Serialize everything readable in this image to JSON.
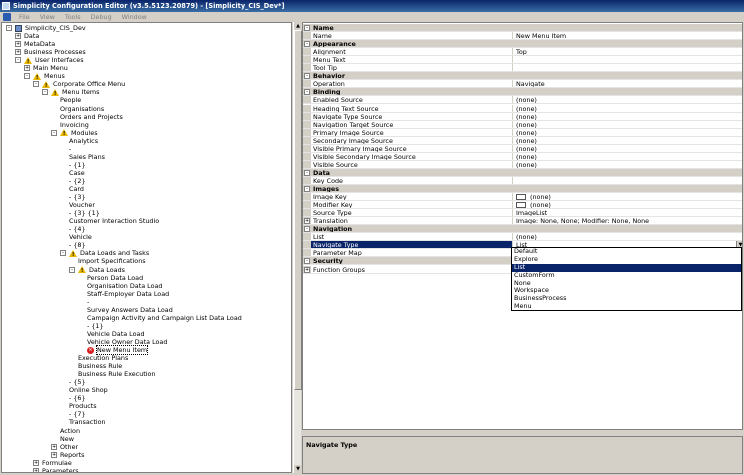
{
  "window": {
    "title": "Simplicity Configuration Editor (v3.5.5123.20879) - [Simplicity_CIS_Dev*]"
  },
  "menubar": {
    "items": [
      "File",
      "View",
      "Tools",
      "Debug",
      "Window"
    ]
  },
  "tree": {
    "nodes": [
      {
        "label": "Simplicity_CIS_Dev",
        "depth": 0,
        "exp": "-",
        "icon": "db-icon"
      },
      {
        "label": "Data",
        "depth": 1,
        "exp": "+",
        "icon": "none"
      },
      {
        "label": "MetaData",
        "depth": 1,
        "exp": "+",
        "icon": "none"
      },
      {
        "label": "Business Processes",
        "depth": 1,
        "exp": "+",
        "icon": "none"
      },
      {
        "label": "User Interfaces",
        "depth": 1,
        "exp": "-",
        "icon": "warn"
      },
      {
        "label": "Main Menu",
        "depth": 2,
        "exp": "+",
        "icon": "none"
      },
      {
        "label": "Menus",
        "depth": 2,
        "exp": "-",
        "icon": "warn"
      },
      {
        "label": "Corporate Office Menu",
        "depth": 3,
        "exp": "-",
        "icon": "warn"
      },
      {
        "label": "Menu Items",
        "depth": 4,
        "exp": "-",
        "icon": "warn"
      },
      {
        "label": "People",
        "depth": 5,
        "exp": "",
        "icon": "none"
      },
      {
        "label": "Organisations",
        "depth": 5,
        "exp": "",
        "icon": "none"
      },
      {
        "label": "Orders and Projects",
        "depth": 5,
        "exp": "",
        "icon": "none"
      },
      {
        "label": "Invoicing",
        "depth": 5,
        "exp": "",
        "icon": "none"
      },
      {
        "label": "Modules",
        "depth": 5,
        "exp": "-",
        "icon": "warn"
      },
      {
        "label": "Analytics",
        "depth": 6,
        "exp": "",
        "icon": "none"
      },
      {
        "label": "-",
        "depth": 6,
        "exp": "",
        "icon": "none"
      },
      {
        "label": "Sales Plans",
        "depth": 6,
        "exp": "",
        "icon": "none"
      },
      {
        "label": "- {1}",
        "depth": 6,
        "exp": "",
        "icon": "none"
      },
      {
        "label": "Case",
        "depth": 6,
        "exp": "",
        "icon": "none"
      },
      {
        "label": "- {2}",
        "depth": 6,
        "exp": "",
        "icon": "none"
      },
      {
        "label": "Card",
        "depth": 6,
        "exp": "",
        "icon": "none"
      },
      {
        "label": "- {3}",
        "depth": 6,
        "exp": "",
        "icon": "none"
      },
      {
        "label": "Voucher",
        "depth": 6,
        "exp": "",
        "icon": "none"
      },
      {
        "label": "- {3} {1}",
        "depth": 6,
        "exp": "",
        "icon": "none"
      },
      {
        "label": "Customer Interaction Studio",
        "depth": 6,
        "exp": "",
        "icon": "none"
      },
      {
        "label": "- {4}",
        "depth": 6,
        "exp": "",
        "icon": "none"
      },
      {
        "label": "Vehicle",
        "depth": 6,
        "exp": "",
        "icon": "none"
      },
      {
        "label": "- {8}",
        "depth": 6,
        "exp": "",
        "icon": "none"
      },
      {
        "label": "Data Loads and Tasks",
        "depth": 6,
        "exp": "-",
        "icon": "warn"
      },
      {
        "label": "Import Specifications",
        "depth": 7,
        "exp": "",
        "icon": "none"
      },
      {
        "label": "Data Loads",
        "depth": 7,
        "exp": "-",
        "icon": "warn"
      },
      {
        "label": "Person Data Load",
        "depth": 8,
        "exp": "",
        "icon": "none"
      },
      {
        "label": "Organisation Data Load",
        "depth": 8,
        "exp": "",
        "icon": "none"
      },
      {
        "label": "Staff-Employer Data Load",
        "depth": 8,
        "exp": "",
        "icon": "none"
      },
      {
        "label": "-",
        "depth": 8,
        "exp": "",
        "icon": "none"
      },
      {
        "label": "Survey Answers Data Load",
        "depth": 8,
        "exp": "",
        "icon": "none"
      },
      {
        "label": "Campaign Activity and Campaign List Data Load",
        "depth": 8,
        "exp": "",
        "icon": "none"
      },
      {
        "label": "- {1}",
        "depth": 8,
        "exp": "",
        "icon": "none"
      },
      {
        "label": "Vehicle Data Load",
        "depth": 8,
        "exp": "",
        "icon": "none"
      },
      {
        "label": "Vehicle Owner Data Load",
        "depth": 8,
        "exp": "",
        "icon": "none"
      },
      {
        "label": "New Menu Item",
        "depth": 8,
        "exp": "",
        "icon": "err"
      },
      {
        "label": "Execution Plans",
        "depth": 7,
        "exp": "",
        "icon": "none"
      },
      {
        "label": "Business Rule",
        "depth": 7,
        "exp": "",
        "icon": "none"
      },
      {
        "label": "Business Rule Execution",
        "depth": 7,
        "exp": "",
        "icon": "none"
      },
      {
        "label": "- {5}",
        "depth": 6,
        "exp": "",
        "icon": "none"
      },
      {
        "label": "Online Shop",
        "depth": 6,
        "exp": "",
        "icon": "none"
      },
      {
        "label": "- {6}",
        "depth": 6,
        "exp": "",
        "icon": "none"
      },
      {
        "label": "Products",
        "depth": 6,
        "exp": "",
        "icon": "none"
      },
      {
        "label": "- {7}",
        "depth": 6,
        "exp": "",
        "icon": "none"
      },
      {
        "label": "Transaction",
        "depth": 6,
        "exp": "",
        "icon": "none"
      },
      {
        "label": "Action",
        "depth": 5,
        "exp": "",
        "icon": "none"
      },
      {
        "label": "New",
        "depth": 5,
        "exp": "",
        "icon": "none"
      },
      {
        "label": "Other",
        "depth": 5,
        "exp": "+",
        "icon": "none"
      },
      {
        "label": "Reports",
        "depth": 5,
        "exp": "+",
        "icon": "none"
      },
      {
        "label": "Formulae",
        "depth": 3,
        "exp": "+",
        "icon": "none"
      },
      {
        "label": "Parameters",
        "depth": 3,
        "exp": "+",
        "icon": "none"
      }
    ]
  },
  "properties": {
    "rows": [
      {
        "type": "cat",
        "label": "Name",
        "value": ""
      },
      {
        "type": "prop",
        "label": "Name",
        "value": "New Menu Item"
      },
      {
        "type": "cat",
        "label": "Appearance",
        "value": ""
      },
      {
        "type": "prop",
        "label": "Alignment",
        "value": "Top"
      },
      {
        "type": "prop",
        "label": "Menu Text",
        "value": ""
      },
      {
        "type": "prop",
        "label": "Tool Tip",
        "value": ""
      },
      {
        "type": "cat",
        "label": "Behavior",
        "value": ""
      },
      {
        "type": "prop",
        "label": "Operation",
        "value": "Navigate"
      },
      {
        "type": "cat",
        "label": "Binding",
        "value": ""
      },
      {
        "type": "prop",
        "label": "Enabled Source",
        "value": "(none)"
      },
      {
        "type": "prop",
        "label": "Heading Text Source",
        "value": "(none)"
      },
      {
        "type": "prop",
        "label": "Navigate Type Source",
        "value": "(none)"
      },
      {
        "type": "prop",
        "label": "Navigation Target Source",
        "value": "(none)"
      },
      {
        "type": "prop",
        "label": "Primary Image Source",
        "value": "(none)"
      },
      {
        "type": "prop",
        "label": "Secondary Image Source",
        "value": "(none)"
      },
      {
        "type": "prop",
        "label": "Visible Primary Image Source",
        "value": "(none)"
      },
      {
        "type": "prop",
        "label": "Visible Secondary Image Source",
        "value": "(none)"
      },
      {
        "type": "prop",
        "label": "Visible Source",
        "value": "(none)"
      },
      {
        "type": "cat",
        "label": "Data",
        "value": ""
      },
      {
        "type": "prop",
        "label": "Key Code",
        "value": ""
      },
      {
        "type": "cat",
        "label": "Images",
        "value": ""
      },
      {
        "type": "swatch",
        "label": "Image Key",
        "value": "(none)"
      },
      {
        "type": "swatch",
        "label": "Modifier Key",
        "value": "(none)"
      },
      {
        "type": "prop",
        "label": "Source Type",
        "value": "ImageList"
      },
      {
        "type": "plus",
        "label": "Translation",
        "value": "Image: None, None; Modifier: None, None"
      },
      {
        "type": "cat",
        "label": "Navigation",
        "value": ""
      },
      {
        "type": "prop",
        "label": "List",
        "value": "(none)"
      },
      {
        "type": "sel",
        "label": "Navigate Type",
        "value": "List"
      },
      {
        "type": "prop",
        "label": "Parameter Map",
        "value": ""
      },
      {
        "type": "cat",
        "label": "Security",
        "value": ""
      },
      {
        "type": "plus",
        "label": "Function Groups",
        "value": ""
      }
    ]
  },
  "dropdown": {
    "options": [
      "Default",
      "Explore",
      "List",
      "CustomForm",
      "None",
      "Workspace",
      "BusinessProcess",
      "Menu"
    ],
    "selected": "List"
  },
  "description": {
    "title": "Navigate Type"
  }
}
